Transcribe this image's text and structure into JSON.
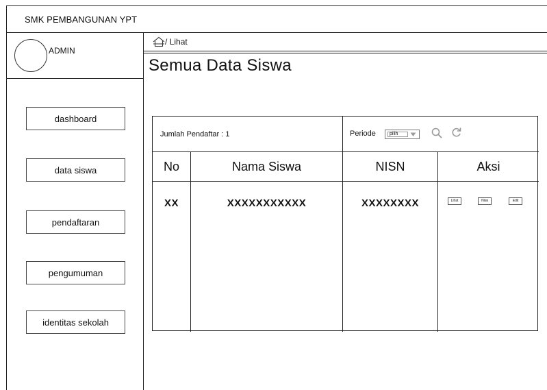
{
  "app": {
    "title": "SMK PEMBANGUNAN YPT"
  },
  "profile": {
    "name": "ADMIN"
  },
  "sidebar": {
    "items": [
      {
        "label": "dashboard"
      },
      {
        "label": "data siswa"
      },
      {
        "label": "pendaftaran"
      },
      {
        "label": "pengumuman"
      },
      {
        "label": "identitas sekolah"
      }
    ]
  },
  "breadcrumb": {
    "separator": "/",
    "current": "Lihat"
  },
  "page": {
    "title": "Semua Data Siswa"
  },
  "table": {
    "count_label": "Jumlah Pendaftar : 1",
    "filter": {
      "label": "Periode",
      "select_value": "pilih"
    },
    "columns": [
      "No",
      "Nama Siswa",
      "NISN",
      "Aksi"
    ],
    "rows": [
      {
        "no": "XX",
        "nama": "XXXXXXXXXXX",
        "nisn": "XXXXXXXX"
      }
    ],
    "actions": [
      "Lihat",
      "Nilai",
      "Edit"
    ]
  },
  "icons": [
    "home-icon",
    "select-arrow-icon",
    "search-icon",
    "refresh-icon"
  ],
  "colors": {
    "line": "#222222",
    "icon": "#9a9a9a"
  }
}
